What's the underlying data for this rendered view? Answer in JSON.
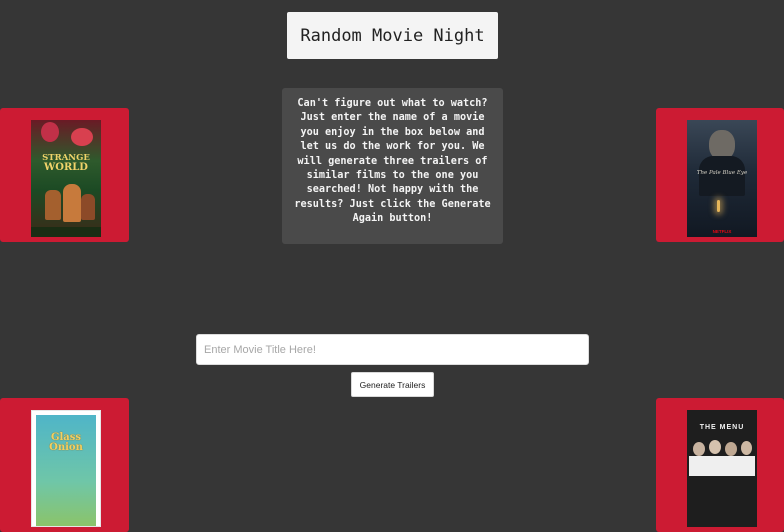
{
  "header": {
    "title": "Random Movie Night"
  },
  "intro": {
    "text": "Can't figure out what to watch? Just enter the name of a movie you enjoy in the box below and let us do the work for you. We will generate three trailers of similar films to the one you searched! Not happy with the results? Just click the Generate Again button!"
  },
  "search": {
    "placeholder": "Enter Movie Title Here!",
    "value": ""
  },
  "generate_button": {
    "label": "Generate Trailers"
  },
  "posters": [
    {
      "title_line1": "STRANGE",
      "title_line2": "WORLD"
    },
    {
      "title": "The Pale Blue Eye",
      "badge": "NETFLIX"
    },
    {
      "title": "Glass Onion"
    },
    {
      "title": "THE MENU"
    }
  ],
  "colors": {
    "background": "#363636",
    "card_accent": "#cc1b33",
    "info_box": "#4a4a4a"
  }
}
